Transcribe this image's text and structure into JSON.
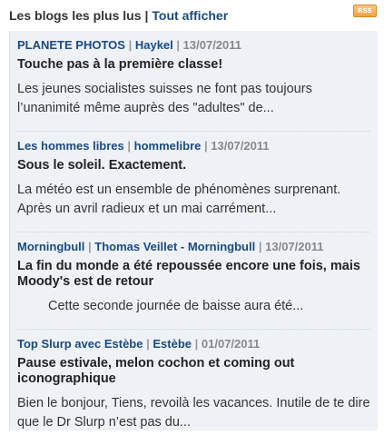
{
  "header": {
    "title": "Les blogs les plus lus",
    "separator": "|",
    "link": "Tout afficher",
    "rss": "RSS"
  },
  "posts": [
    {
      "blog": "PLANETE PHOTOS",
      "author": "Haykel",
      "date": "13/07/2011",
      "title": "Touche pas à la première classe!",
      "excerpt": "Les jeunes socialistes suisses ne font pas toujours l’unanimité même auprès des \"adultes\" de..."
    },
    {
      "blog": "Les hommes libres",
      "author": "hommelibre",
      "date": "13/07/2011",
      "title": "Sous le soleil. Exactement.",
      "excerpt": "La météo est un ensemble de phénomènes surprenant. Après un avril radieux et un mai carrément..."
    },
    {
      "blog": "Morningbull",
      "author": "Thomas Veillet - Morningbull",
      "date": "13/07/2011",
      "title": "La fin du monde a été repoussée encore une fois, mais Moody's est de retour",
      "excerpt": "Cette seconde journée de baisse aura été..."
    },
    {
      "blog": "Top Slurp avec Estèbe",
      "author": "Estèbe",
      "date": "01/07/2011",
      "title": "Pause estivale, melon cochon et coming out iconographique",
      "excerpt": "Bien le bonjour, Tiens, revoilà les vacances. Inutile de te dire que le Dr Slurp n’est pas du..."
    }
  ]
}
